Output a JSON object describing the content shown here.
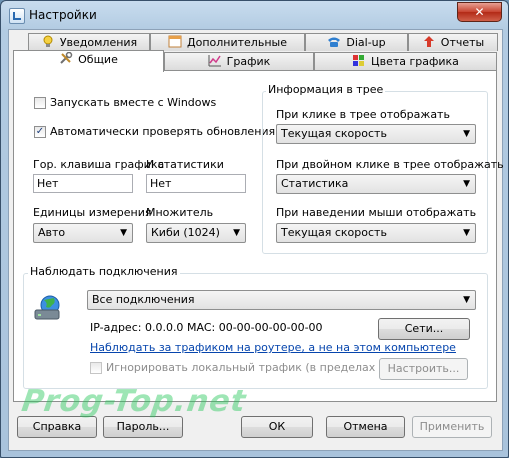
{
  "window": {
    "title": "Настройки",
    "close_label": "✕"
  },
  "tabs": {
    "notifications": "Уведомления",
    "advanced": "Дополнительные",
    "dialup": "Dial-up",
    "reports": "Отчеты",
    "general": "Общие",
    "graph": "График",
    "graph_colors": "Цвета графика"
  },
  "general": {
    "start_with_windows": {
      "label": "Запускать вместе с Windows",
      "checked": false
    },
    "auto_update": {
      "label": "Автоматически проверять обновления",
      "checked": true
    },
    "hotkey_graph_label": "Гор. клавиша графика",
    "hotkey_graph_value": "Нет",
    "hotkey_stats_label": "И статистики",
    "hotkey_stats_value": "Нет",
    "units_label": "Единицы измерения",
    "units_value": "Авто",
    "multiplier_label": "Множитель",
    "multiplier_value": "Киби (1024)"
  },
  "tray": {
    "title": "Информация в трее",
    "click_label": "При клике в трее отображать",
    "click_value": "Текущая скорость",
    "dblclick_label": "При двойном клике в трее отображать",
    "dblclick_value": "Статистика",
    "hover_label": "При наведении мыши отображать",
    "hover_value": "Текущая скорость"
  },
  "monitor": {
    "title": "Наблюдать подключения",
    "connection_value": "Все подключения",
    "ip_text": "IP-адрес: 0.0.0.0",
    "mac_text": "MAC: 00-00-00-00-00-00",
    "networks_button": "Сети...",
    "router_link": "Наблюдать за трафиком на роутере, а не на этом компьютере",
    "ignore_local": "Игнорировать локальный трафик (в пределах сети",
    "configure_button": "Настроить..."
  },
  "footer": {
    "help": "Справка",
    "password": "Пароль...",
    "ok": "ОК",
    "cancel": "Отмена",
    "apply": "Применить"
  },
  "watermark": "Prog-Top.net",
  "colors": {
    "title_bar": "#b2cbe2",
    "close_button": "#c7432f",
    "link": "#0645ad",
    "watermark": "#28c85a"
  }
}
